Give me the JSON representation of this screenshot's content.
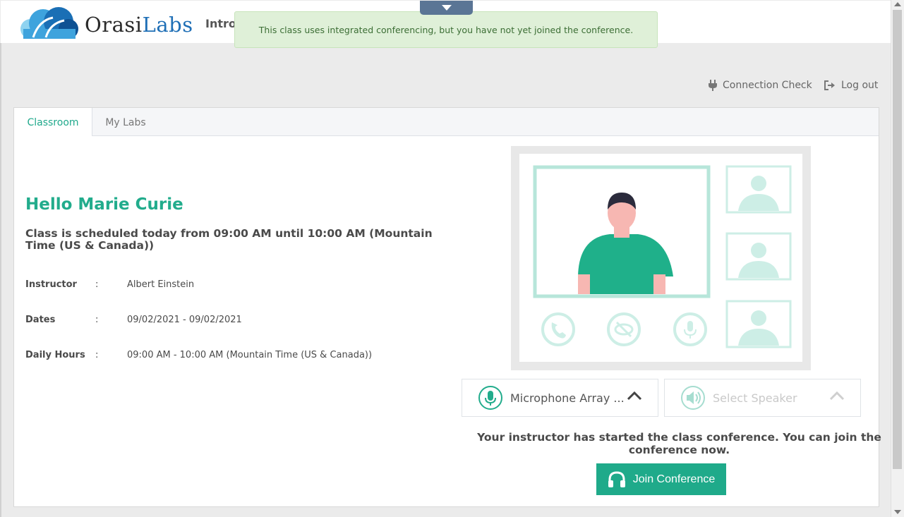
{
  "header": {
    "logo": {
      "text_part1": "Orasi",
      "text_part2": "Labs",
      "brand_color": "#1f6fb6"
    },
    "class_title_partial": "Intro",
    "toggle_icon": "caret-down-icon"
  },
  "alert": {
    "message": "This class uses integrated conferencing, but you have not yet joined the conference."
  },
  "utility_links": {
    "connection_check": "Connection Check",
    "logout": "Log out"
  },
  "tabs": [
    {
      "label": "Classroom",
      "active": true
    },
    {
      "label": "My Labs",
      "active": false
    }
  ],
  "classroom": {
    "greeting": "Hello Marie Curie",
    "schedule": "Class is scheduled today from 09:00 AM until 10:00 AM (Mountain Time (US & Canada))",
    "details": [
      {
        "label": "Instructor",
        "sep": ":",
        "value": "Albert Einstein"
      },
      {
        "label": "Dates",
        "sep": ":",
        "value": "09/02/2021 - 09/02/2021"
      },
      {
        "label": "Daily Hours",
        "sep": ":",
        "value": "09:00 AM - 10:00 AM (Mountain Time (US & Canada))"
      }
    ]
  },
  "conference": {
    "microphone_label": "Microphone Array ...",
    "speaker_placeholder": "Select Speaker",
    "status_message": "Your instructor has started the class conference. You can join the conference now.",
    "join_button": "Join Conference"
  },
  "colors": {
    "accent": "#22ac8c",
    "button": "#1faa8a",
    "alert_bg": "#dff0d8",
    "alert_text": "#3c6e35",
    "toggle_tab": "#5a7595"
  }
}
